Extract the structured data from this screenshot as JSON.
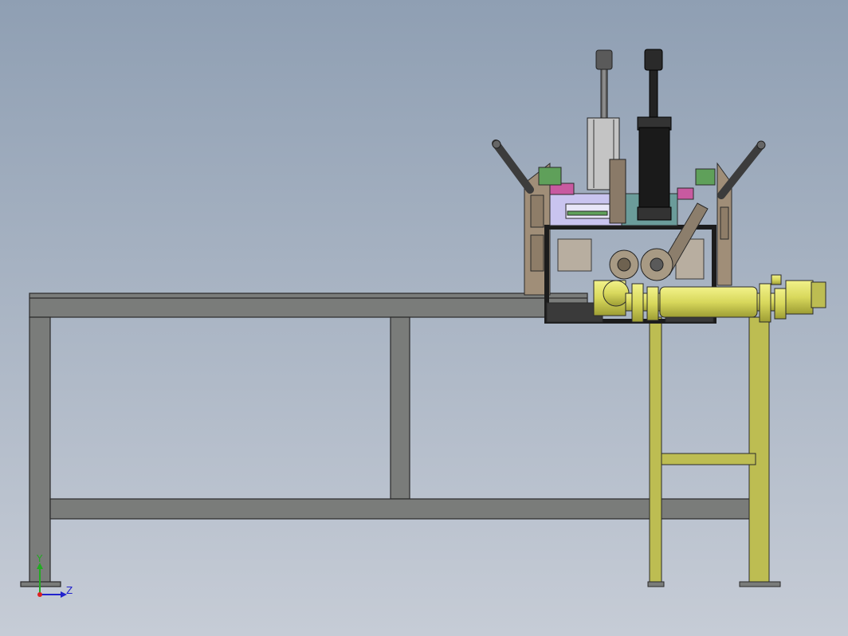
{
  "viewport": {
    "background_top": "#8f9fb3",
    "background_bottom": "#c6ccd6"
  },
  "colors": {
    "frame_steel": "#7a7c7a",
    "frame_edge": "#2a2a2a",
    "support_olive": "#bdbd52",
    "cylinder_yellow": "#d8d85c",
    "panel_brown": "#a08e78",
    "panel_dark": "#3a3a3a",
    "actuator_black": "#1a1a1a",
    "accent_green": "#5fa05a",
    "accent_pink": "#c85aa0",
    "accent_lavender": "#c9c4ef",
    "axis_x": "#d22",
    "axis_y": "#2a2",
    "axis_z": "#22c"
  },
  "triad": {
    "y_label": "Y",
    "z_label": "Z"
  }
}
